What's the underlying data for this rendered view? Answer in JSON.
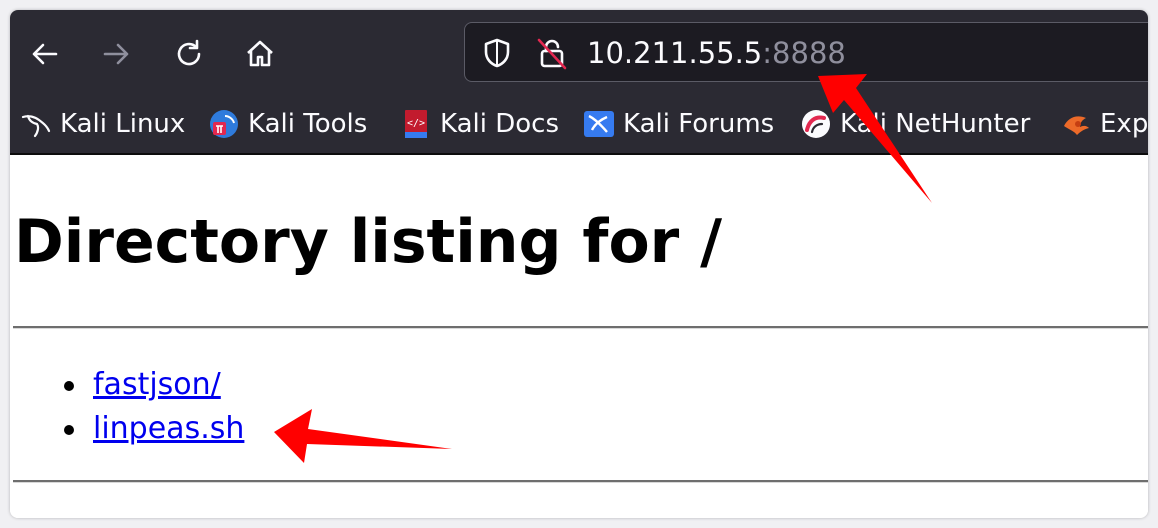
{
  "toolbar": {
    "back_icon": "arrow-left-icon",
    "forward_icon": "arrow-right-icon",
    "reload_icon": "reload-icon",
    "home_icon": "home-icon"
  },
  "urlbar": {
    "shield_icon": "tracking-protection-shield-icon",
    "insecure_icon": "insecure-lock-icon",
    "host": "10.211.55.5",
    "port": ":8888"
  },
  "bookmarks": [
    {
      "label": "Kali Linux",
      "icon": "kali-dragon-icon"
    },
    {
      "label": "Kali Tools",
      "icon": "kali-tools-icon"
    },
    {
      "label": "Kali Docs",
      "icon": "kali-docs-icon"
    },
    {
      "label": "Kali Forums",
      "icon": "kali-forums-icon"
    },
    {
      "label": "Kali NetHunter",
      "icon": "kali-nethunter-icon"
    },
    {
      "label": "Exp",
      "icon": "exploit-db-icon"
    }
  ],
  "page": {
    "title": "Directory listing for /",
    "files": [
      {
        "name": "fastjson/"
      },
      {
        "name": "linpeas.sh"
      }
    ]
  },
  "colors": {
    "toolbar_bg": "#2b2a33",
    "urlbar_bg": "#1c1b22",
    "link": "#0000ee",
    "annotation_arrow": "#ff0000"
  }
}
